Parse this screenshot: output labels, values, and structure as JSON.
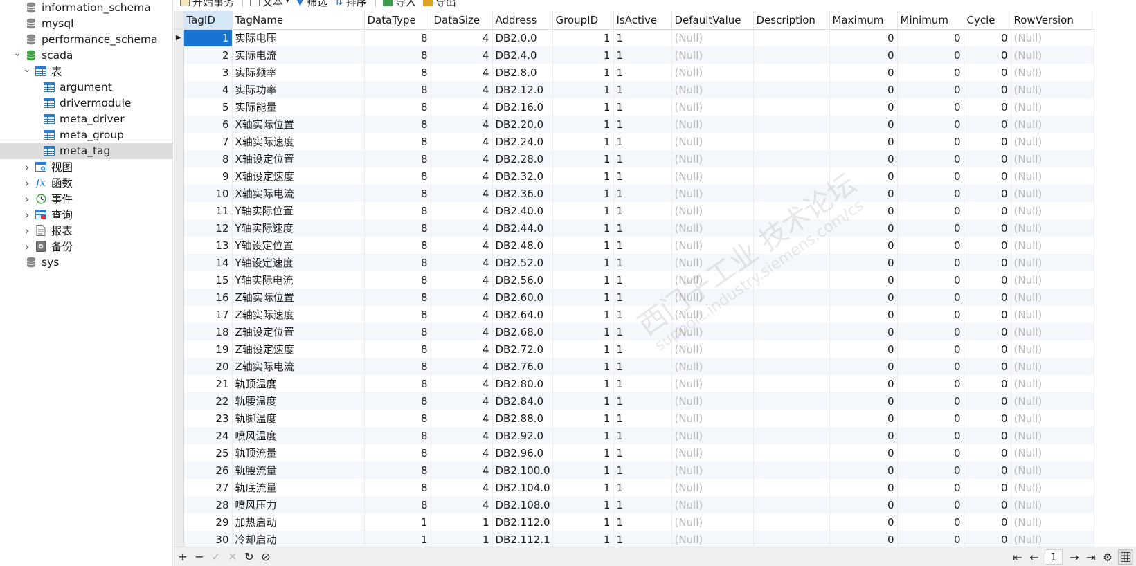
{
  "toolbar": {
    "begin_transaction": "开始事务",
    "text": "文本",
    "filter": "筛选",
    "sort": "排序",
    "import": "导入",
    "export": "导出"
  },
  "sidebar": {
    "items": [
      {
        "label": "information_schema",
        "icon": "database-icon",
        "level": 1
      },
      {
        "label": "mysql",
        "icon": "database-icon",
        "level": 1
      },
      {
        "label": "performance_schema",
        "icon": "database-icon",
        "level": 1
      },
      {
        "label": "scada",
        "icon": "database-open-icon",
        "level": 1,
        "expanded": true
      },
      {
        "label": "表",
        "icon": "tables-icon",
        "level": 2,
        "expanded": true
      },
      {
        "label": "argument",
        "icon": "table-icon",
        "level": 3
      },
      {
        "label": "drivermodule",
        "icon": "table-icon",
        "level": 3
      },
      {
        "label": "meta_driver",
        "icon": "table-icon",
        "level": 3
      },
      {
        "label": "meta_group",
        "icon": "table-icon",
        "level": 3
      },
      {
        "label": "meta_tag",
        "icon": "table-icon",
        "level": 3,
        "selected": true
      },
      {
        "label": "视图",
        "icon": "view-icon",
        "level": 2
      },
      {
        "label": "函数",
        "icon": "function-icon",
        "level": 2
      },
      {
        "label": "事件",
        "icon": "event-icon",
        "level": 2
      },
      {
        "label": "查询",
        "icon": "query-icon",
        "level": 2
      },
      {
        "label": "报表",
        "icon": "report-icon",
        "level": 2
      },
      {
        "label": "备份",
        "icon": "backup-icon",
        "level": 2
      },
      {
        "label": "sys",
        "icon": "database-icon",
        "level": 1
      }
    ]
  },
  "grid": {
    "columns": [
      "TagID",
      "TagName",
      "DataType",
      "DataSize",
      "Address",
      "GroupID",
      "IsActive",
      "DefaultValue",
      "Description",
      "Maximum",
      "Minimum",
      "Cycle",
      "RowVersion"
    ],
    "null_text": "(Null)",
    "rows": [
      [
        1,
        "实际电压",
        8,
        4,
        "DB2.0.0",
        1,
        1,
        0,
        0,
        0
      ],
      [
        2,
        "实际电流",
        8,
        4,
        "DB2.4.0",
        1,
        1,
        0,
        0,
        0
      ],
      [
        3,
        "实际频率",
        8,
        4,
        "DB2.8.0",
        1,
        1,
        0,
        0,
        0
      ],
      [
        4,
        "实际功率",
        8,
        4,
        "DB2.12.0",
        1,
        1,
        0,
        0,
        0
      ],
      [
        5,
        "实际能量",
        8,
        4,
        "DB2.16.0",
        1,
        1,
        0,
        0,
        0
      ],
      [
        6,
        "X轴实际位置",
        8,
        4,
        "DB2.20.0",
        1,
        1,
        0,
        0,
        0
      ],
      [
        7,
        "X轴实际速度",
        8,
        4,
        "DB2.24.0",
        1,
        1,
        0,
        0,
        0
      ],
      [
        8,
        "X轴设定位置",
        8,
        4,
        "DB2.28.0",
        1,
        1,
        0,
        0,
        0
      ],
      [
        9,
        "X轴设定速度",
        8,
        4,
        "DB2.32.0",
        1,
        1,
        0,
        0,
        0
      ],
      [
        10,
        "X轴实际电流",
        8,
        4,
        "DB2.36.0",
        1,
        1,
        0,
        0,
        0
      ],
      [
        11,
        "Y轴实际位置",
        8,
        4,
        "DB2.40.0",
        1,
        1,
        0,
        0,
        0
      ],
      [
        12,
        "Y轴实际速度",
        8,
        4,
        "DB2.44.0",
        1,
        1,
        0,
        0,
        0
      ],
      [
        13,
        "Y轴设定位置",
        8,
        4,
        "DB2.48.0",
        1,
        1,
        0,
        0,
        0
      ],
      [
        14,
        "Y轴设定速度",
        8,
        4,
        "DB2.52.0",
        1,
        1,
        0,
        0,
        0
      ],
      [
        15,
        "Y轴实际电流",
        8,
        4,
        "DB2.56.0",
        1,
        1,
        0,
        0,
        0
      ],
      [
        16,
        "Z轴实际位置",
        8,
        4,
        "DB2.60.0",
        1,
        1,
        0,
        0,
        0
      ],
      [
        17,
        "Z轴实际速度",
        8,
        4,
        "DB2.64.0",
        1,
        1,
        0,
        0,
        0
      ],
      [
        18,
        "Z轴设定位置",
        8,
        4,
        "DB2.68.0",
        1,
        1,
        0,
        0,
        0
      ],
      [
        19,
        "Z轴设定速度",
        8,
        4,
        "DB2.72.0",
        1,
        1,
        0,
        0,
        0
      ],
      [
        20,
        "Z轴实际电流",
        8,
        4,
        "DB2.76.0",
        1,
        1,
        0,
        0,
        0
      ],
      [
        21,
        "轨顶温度",
        8,
        4,
        "DB2.80.0",
        1,
        1,
        0,
        0,
        0
      ],
      [
        22,
        "轨腰温度",
        8,
        4,
        "DB2.84.0",
        1,
        1,
        0,
        0,
        0
      ],
      [
        23,
        "轨脚温度",
        8,
        4,
        "DB2.88.0",
        1,
        1,
        0,
        0,
        0
      ],
      [
        24,
        "喷风温度",
        8,
        4,
        "DB2.92.0",
        1,
        1,
        0,
        0,
        0
      ],
      [
        25,
        "轨顶流量",
        8,
        4,
        "DB2.96.0",
        1,
        1,
        0,
        0,
        0
      ],
      [
        26,
        "轨腰流量",
        8,
        4,
        "DB2.100.0",
        1,
        1,
        0,
        0,
        0
      ],
      [
        27,
        "轨底流量",
        8,
        4,
        "DB2.104.0",
        1,
        1,
        0,
        0,
        0
      ],
      [
        28,
        "喷风压力",
        8,
        4,
        "DB2.108.0",
        1,
        1,
        0,
        0,
        0
      ],
      [
        29,
        "加热启动",
        1,
        1,
        "DB2.112.0",
        1,
        1,
        0,
        0,
        0
      ],
      [
        30,
        "冷却启动",
        1,
        1,
        "DB2.112.1",
        1,
        1,
        0,
        0,
        0
      ]
    ]
  },
  "watermark": {
    "line1": "西门子工业 技术论坛",
    "line2": "support.industry.siemens.com/cs"
  },
  "pager": {
    "page": "1"
  },
  "colors": {
    "selection": "#1874d2",
    "alt_row": "#f4f8fc",
    "null_text": "#b8b8b8",
    "db_green": "#3aa53a"
  }
}
